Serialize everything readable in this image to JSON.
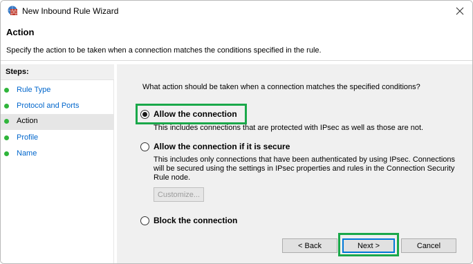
{
  "window": {
    "title": "New Inbound Rule Wizard"
  },
  "header": {
    "title": "Action",
    "description": "Specify the action to be taken when a connection matches the conditions specified in the rule."
  },
  "steps": {
    "heading": "Steps:",
    "items": [
      {
        "label": "Rule Type",
        "current": false
      },
      {
        "label": "Protocol and Ports",
        "current": false
      },
      {
        "label": "Action",
        "current": true
      },
      {
        "label": "Profile",
        "current": false
      },
      {
        "label": "Name",
        "current": false
      }
    ]
  },
  "main": {
    "question": "What action should be taken when a connection matches the specified conditions?",
    "options": [
      {
        "label": "Allow the connection",
        "description": "This includes connections that are protected with IPsec as well as those are not.",
        "selected": true
      },
      {
        "label": "Allow the connection if it is secure",
        "description_lines": [
          "This includes only connections that have been authenticated by using IPsec.  Connections",
          "will be secured using the settings in IPsec properties and rules in the Connection Security",
          "Rule node."
        ],
        "selected": false
      },
      {
        "label": "Block the connection",
        "selected": false
      }
    ],
    "customize_label": "Customize..."
  },
  "buttons": {
    "back": "< Back",
    "next": "Next >",
    "cancel": "Cancel"
  },
  "colors": {
    "highlight": "#1aa84a",
    "step_bullet": "#2fb53b",
    "step_link": "#0066cc",
    "content_bg": "#f0f0f0"
  }
}
